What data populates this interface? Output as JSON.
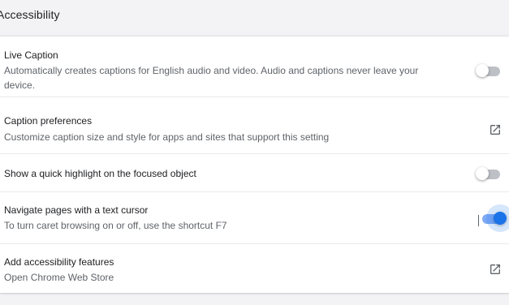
{
  "section": {
    "title": "Accessibility"
  },
  "settings": [
    {
      "title": "Live Caption",
      "subtitle": "Automatically creates captions for English audio and video. Audio and captions never leave your device.",
      "control": "toggle",
      "enabled": false
    },
    {
      "title": "Caption preferences",
      "subtitle": "Customize caption size and style for apps and sites that support this setting",
      "control": "open-in-new-icon"
    },
    {
      "title": "Show a quick highlight on the focused object",
      "control": "toggle",
      "enabled": false
    },
    {
      "title": "Navigate pages with a text cursor",
      "subtitle": "To turn caret browsing on or off, use the shortcut F7",
      "control": "toggle",
      "enabled": true
    },
    {
      "title": "Add accessibility features",
      "subtitle": "Open Chrome Web Store",
      "control": "open-in-new-icon"
    }
  ],
  "colors": {
    "accent": "#1a73e8",
    "toggle_off_track": "#bdc1c6",
    "toggle_on_track": "#7eaaf5",
    "text_primary": "#202124",
    "text_secondary": "#5f6368",
    "background": "#f3f3f5"
  }
}
